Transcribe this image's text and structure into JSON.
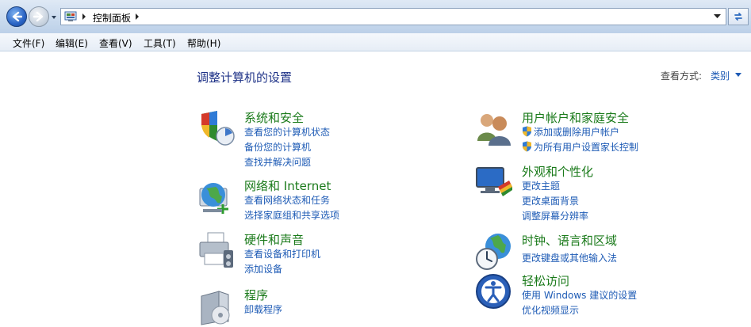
{
  "address": {
    "path_root": "控制面板"
  },
  "menu": {
    "items": [
      "文件(F)",
      "编辑(E)",
      "查看(V)",
      "工具(T)",
      "帮助(H)"
    ]
  },
  "content": {
    "title": "调整计算机的设置",
    "view_label": "查看方式:",
    "view_value": "类别"
  },
  "categories": {
    "system": {
      "title": "系统和安全",
      "links": [
        "查看您的计算机状态",
        "备份您的计算机",
        "查找并解决问题"
      ]
    },
    "network": {
      "title": "网络和 Internet",
      "links": [
        "查看网络状态和任务",
        "选择家庭组和共享选项"
      ]
    },
    "hardware": {
      "title": "硬件和声音",
      "links": [
        "查看设备和打印机",
        "添加设备"
      ]
    },
    "programs": {
      "title": "程序",
      "links": [
        "卸载程序"
      ]
    },
    "users": {
      "title": "用户帐户和家庭安全",
      "links": [
        "添加或删除用户帐户",
        "为所有用户设置家长控制"
      ]
    },
    "appearance": {
      "title": "外观和个性化",
      "links": [
        "更改主题",
        "更改桌面背景",
        "调整屏幕分辨率"
      ]
    },
    "clock": {
      "title": "时钟、语言和区域",
      "links": [
        "更改键盘或其他输入法"
      ]
    },
    "ease": {
      "title": "轻松访问",
      "links": [
        "使用 Windows 建议的设置",
        "优化视频显示"
      ]
    }
  },
  "colors": {
    "category_title": "#1a7a1a",
    "link": "#1e5bb5",
    "page_title": "#1e3287"
  }
}
